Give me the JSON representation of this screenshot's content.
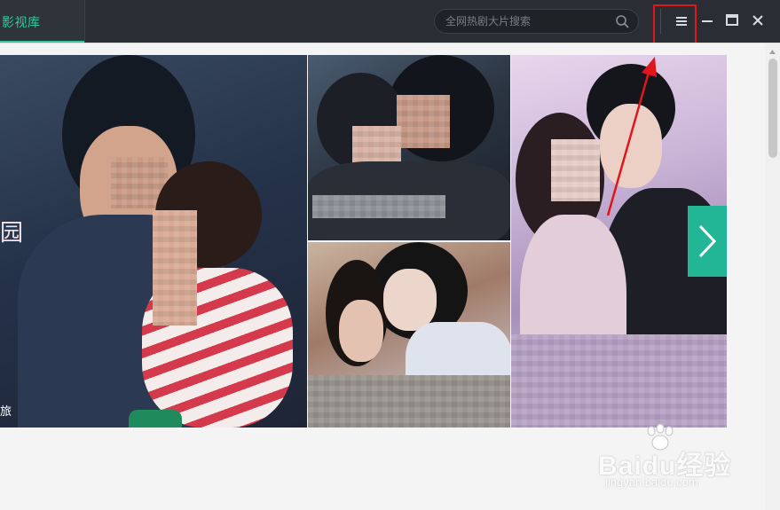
{
  "titlebar": {
    "active_tab_label": "影视库",
    "search_placeholder": "全网热剧大片搜索",
    "icons": {
      "search": "search-icon",
      "menu": "hamburger-menu-icon",
      "minimize": "minimize-icon",
      "maximize": "maximize-icon",
      "close": "close-icon"
    }
  },
  "banner": {
    "tile1_title_fragment": "园",
    "tile1_caption_fragment": "旅",
    "next_icon": "chevron-right-icon"
  },
  "watermark": {
    "brand": "Baidu经验",
    "url": "jingyan.baidu.com"
  },
  "colors": {
    "accent": "#2fcaa0",
    "titlebar_bg": "#2a2d34",
    "highlight_box": "#e0161d",
    "next_button": "#22b697"
  }
}
